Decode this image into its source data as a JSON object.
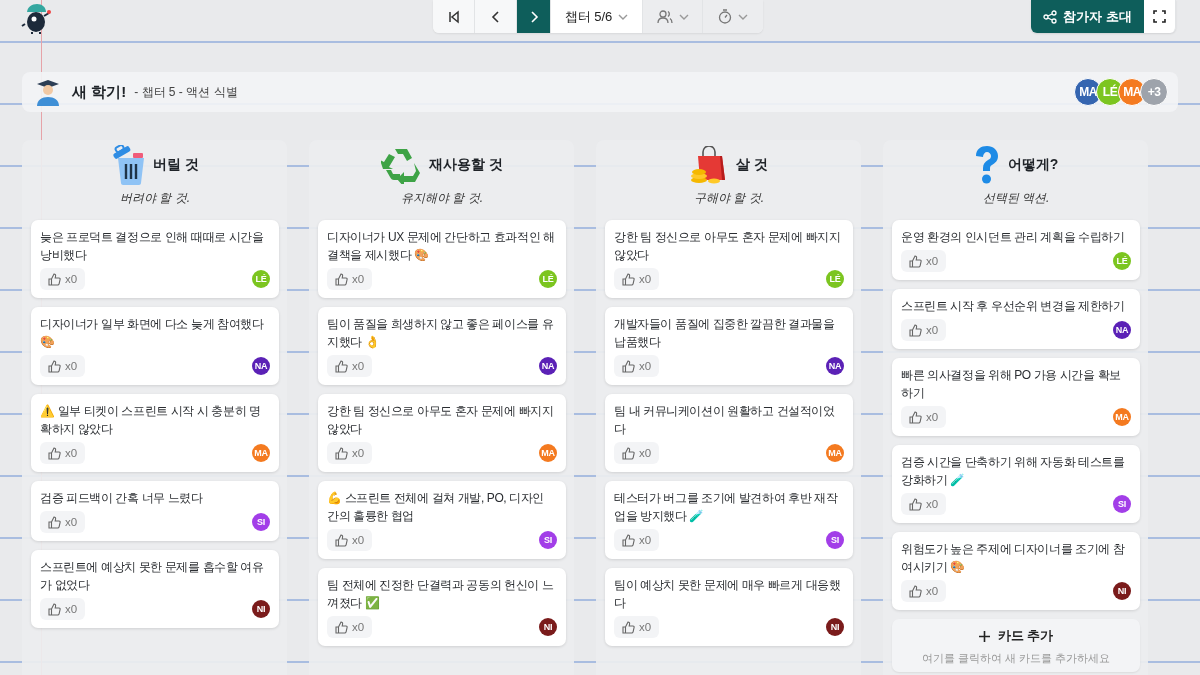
{
  "toolbar": {
    "chapter": "챕터 5/6",
    "invite": "참가자 초대"
  },
  "header": {
    "title": "새 학기!",
    "subtitle": "- 챕터 5 - 액션 식별",
    "participants": [
      {
        "initials": "MA",
        "color": "#3565b0"
      },
      {
        "initials": "LÉ",
        "color": "#7cc520"
      },
      {
        "initials": "MA",
        "color": "#f47a20"
      }
    ],
    "more": "+3"
  },
  "columns": [
    {
      "kind": "trash",
      "title": "버릴 것",
      "subtitle": "버려야 할 것.",
      "cards": [
        {
          "text": "늦은 프로덕트 결정으로 인해 때때로 시간을 낭비했다",
          "votes": "x0",
          "author": "LÉ",
          "color": "#7cc520"
        },
        {
          "text": "디자이너가 일부 화면에 다소 늦게 참여했다 🎨",
          "votes": "x0",
          "author": "NA",
          "color": "#5b21b6"
        },
        {
          "text": "⚠️ 일부 티켓이 스프린트 시작 시 충분히 명확하지 않았다",
          "votes": "x0",
          "author": "MA",
          "color": "#f47a20"
        },
        {
          "text": "검증 피드백이 간혹 너무 느렸다",
          "votes": "x0",
          "author": "SI",
          "color": "#a23ee8"
        },
        {
          "text": "스프린트에 예상치 못한 문제를 흡수할 여유가 없었다",
          "votes": "x0",
          "author": "NI",
          "color": "#7a1b1b"
        }
      ]
    },
    {
      "kind": "recycle",
      "title": "재사용할 것",
      "subtitle": "유지해야 할 것.",
      "cards": [
        {
          "text": "디자이너가 UX 문제에 간단하고 효과적인 해결책을 제시했다 🎨",
          "votes": "x0",
          "author": "LÉ",
          "color": "#7cc520"
        },
        {
          "text": "팀이 품질을 희생하지 않고 좋은 페이스를 유지했다 👌",
          "votes": "x0",
          "author": "NA",
          "color": "#5b21b6"
        },
        {
          "text": "강한 팀 정신으로 아무도 혼자 문제에 빠지지 않았다",
          "votes": "x0",
          "author": "MA",
          "color": "#f47a20"
        },
        {
          "text": "💪 스프린트 전체에 걸쳐 개발, PO, 디자인 간의 훌륭한 협업",
          "votes": "x0",
          "author": "SI",
          "color": "#a23ee8"
        },
        {
          "text": "팀 전체에 진정한 단결력과 공동의 헌신이 느껴졌다 ✅",
          "votes": "x0",
          "author": "NI",
          "color": "#7a1b1b"
        }
      ]
    },
    {
      "kind": "buy",
      "title": "살 것",
      "subtitle": "구해야 할 것.",
      "cards": [
        {
          "text": "강한 팀 정신으로 아무도 혼자 문제에 빠지지 않았다",
          "votes": "x0",
          "author": "LÉ",
          "color": "#7cc520"
        },
        {
          "text": "개발자들이 품질에 집중한 깔끔한 결과물을 납품했다",
          "votes": "x0",
          "author": "NA",
          "color": "#5b21b6"
        },
        {
          "text": "팀 내 커뮤니케이션이 원활하고 건설적이었다",
          "votes": "x0",
          "author": "MA",
          "color": "#f47a20"
        },
        {
          "text": "테스터가 버그를 조기에 발견하여 후반 재작업을 방지했다 🧪",
          "votes": "x0",
          "author": "SI",
          "color": "#a23ee8"
        },
        {
          "text": "팀이 예상치 못한 문제에 매우 빠르게 대응했다",
          "votes": "x0",
          "author": "NI",
          "color": "#7a1b1b"
        }
      ]
    },
    {
      "kind": "question",
      "title": "어떻게?",
      "subtitle": "선택된 액션.",
      "cards": [
        {
          "text": "운영 환경의 인시던트 관리 계획을 수립하기",
          "votes": "x0",
          "author": "LÉ",
          "color": "#7cc520"
        },
        {
          "text": "스프린트 시작 후 우선순위 변경을 제한하기",
          "votes": "x0",
          "author": "NA",
          "color": "#5b21b6"
        },
        {
          "text": "빠른 의사결정을 위해 PO 가용 시간을 확보하기",
          "votes": "x0",
          "author": "MA",
          "color": "#f47a20"
        },
        {
          "text": "검증 시간을 단축하기 위해 자동화 테스트를 강화하기 🧪",
          "votes": "x0",
          "author": "SI",
          "color": "#a23ee8"
        },
        {
          "text": "위험도가 높은 주제에 디자이너를 조기에 참여시키기 🎨",
          "votes": "x0",
          "author": "NI",
          "color": "#7a1b1b"
        }
      ],
      "add_card": {
        "label": "카드 추가",
        "hint": "여기를 클릭하여 새 카드를 추가하세요"
      }
    }
  ]
}
